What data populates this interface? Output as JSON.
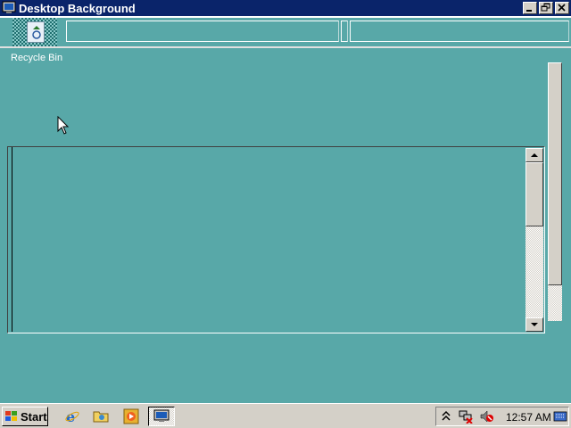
{
  "window": {
    "title": "Desktop Background"
  },
  "desktop": {
    "recycle_bin_label": "Recycle Bin",
    "background_color": "#58a8a8"
  },
  "taskbar": {
    "start_label": "Start",
    "clock": "12:57 AM",
    "quick_launch": [
      "internet-explorer-icon",
      "folder-icon",
      "media-player-icon"
    ],
    "tray_icons": [
      "expand-arrow-icon",
      "network-icon",
      "volume-muted-icon",
      "keyboard-icon"
    ]
  },
  "colors": {
    "title_bar": "#0a246a",
    "chrome": "#d4d0c8"
  }
}
